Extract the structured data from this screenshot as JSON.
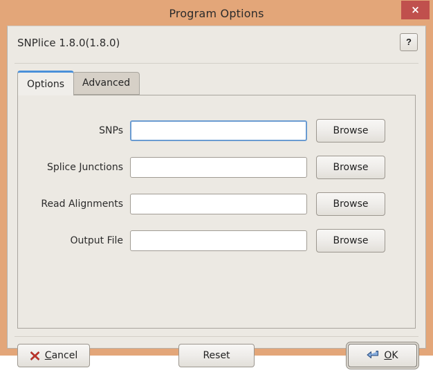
{
  "window": {
    "title": "Program Options",
    "frame_color": "#e3a679",
    "body_color": "#ece9e3",
    "close_button": {
      "label": "×",
      "icon": "close-icon",
      "color": "#c0504d"
    }
  },
  "header": {
    "app_name": "SNPlice 1.8.0(1.8.0)",
    "help_button": {
      "label": "?",
      "icon": "help-icon"
    }
  },
  "tabs": [
    {
      "label": "Options",
      "active": true
    },
    {
      "label": "Advanced",
      "active": false
    }
  ],
  "form": {
    "rows": [
      {
        "label": "SNPs",
        "value": "",
        "placeholder": "",
        "focused": true,
        "browse_label": "Browse"
      },
      {
        "label": "Splice Junctions",
        "value": "",
        "placeholder": "",
        "focused": false,
        "browse_label": "Browse"
      },
      {
        "label": "Read Alignments",
        "value": "",
        "placeholder": "",
        "focused": false,
        "browse_label": "Browse"
      },
      {
        "label": "Output File",
        "value": "",
        "placeholder": "",
        "focused": false,
        "browse_label": "Browse"
      }
    ]
  },
  "buttons": {
    "cancel": {
      "label": "Cancel",
      "mnemonic": "C",
      "icon": "red-x-icon"
    },
    "reset": {
      "label": "Reset",
      "icon": ""
    },
    "ok": {
      "label": "OK",
      "mnemonic": "O",
      "icon": "enter-arrow-icon"
    }
  },
  "colors": {
    "accent_blue": "#4a90d9",
    "focus_blue": "#6a9bd1",
    "close_red": "#c0504d",
    "cancel_x_red": "#c0342b",
    "titlebar": "#e3a679"
  }
}
